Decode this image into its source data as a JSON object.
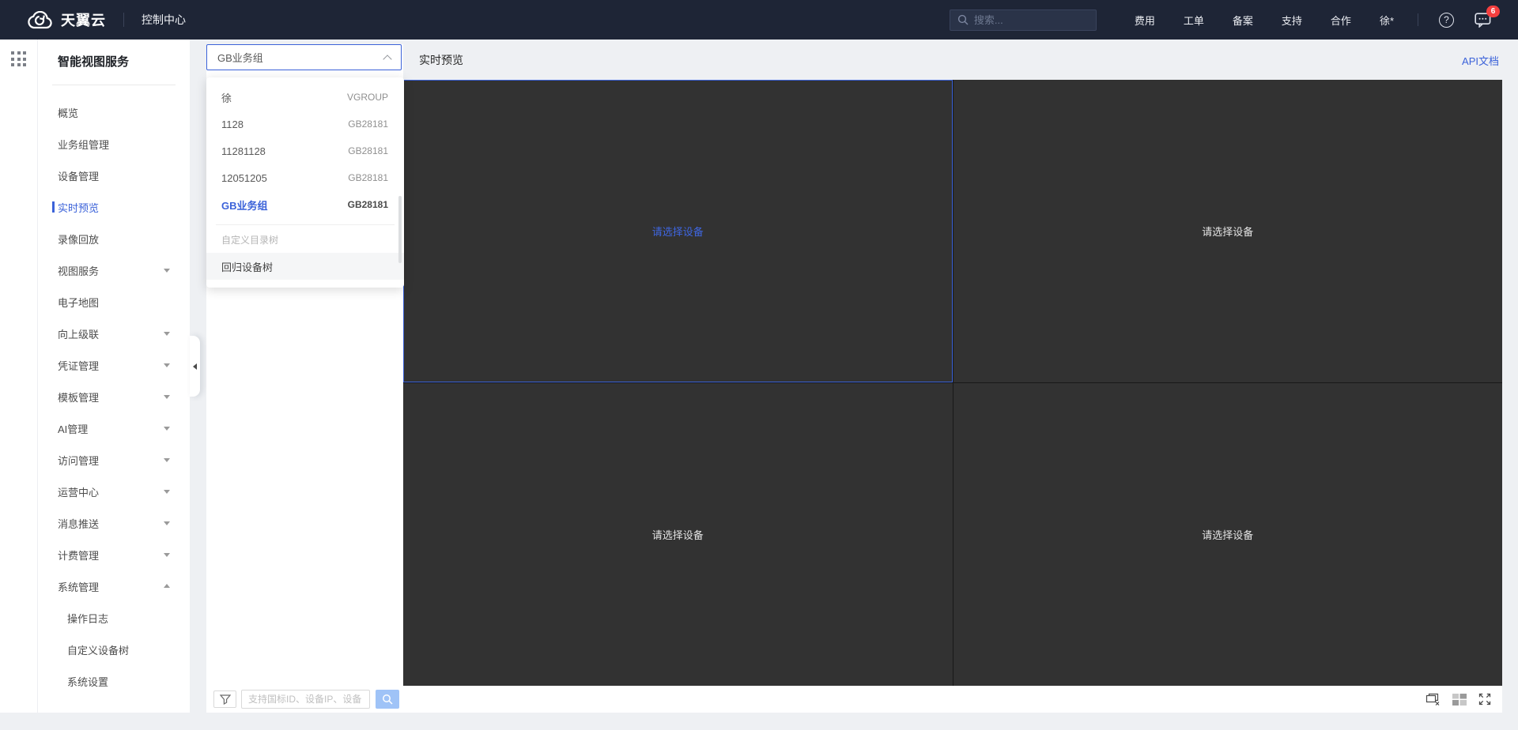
{
  "header": {
    "brand": "天翼云",
    "console": "控制中心",
    "search_placeholder": "搜索...",
    "nav": [
      {
        "label": "费用"
      },
      {
        "label": "工单"
      },
      {
        "label": "备案"
      },
      {
        "label": "支持"
      },
      {
        "label": "合作"
      },
      {
        "label": "徐*"
      }
    ],
    "help_glyph": "?",
    "message_badge": "6"
  },
  "app_sidebar": {
    "title": "智能视图服务",
    "items": [
      {
        "label": "概览"
      },
      {
        "label": "业务组管理"
      },
      {
        "label": "设备管理"
      },
      {
        "label": "实时预览"
      },
      {
        "label": "录像回放"
      },
      {
        "label": "视图服务"
      },
      {
        "label": "电子地图"
      },
      {
        "label": "向上级联"
      },
      {
        "label": "凭证管理"
      },
      {
        "label": "模板管理"
      },
      {
        "label": "AI管理"
      },
      {
        "label": "访问管理"
      },
      {
        "label": "运营中心"
      },
      {
        "label": "消息推送"
      },
      {
        "label": "计费管理"
      },
      {
        "label": "系统管理"
      }
    ],
    "subitems": [
      {
        "label": "操作日志"
      },
      {
        "label": "自定义设备树"
      },
      {
        "label": "系统设置"
      }
    ]
  },
  "page": {
    "title": "实时预览",
    "api_doc_link": "API文档"
  },
  "device_panel": {
    "group_select_value": "GB业务组",
    "dropdown_options": [
      {
        "name": "徐",
        "type": "VGROUP"
      },
      {
        "name": "1128",
        "type": "GB28181"
      },
      {
        "name": "11281128",
        "type": "GB28181"
      },
      {
        "name": "12051205",
        "type": "GB28181"
      },
      {
        "name": "GB业务组",
        "type": "GB28181"
      }
    ],
    "dropdown_group_label": "自定义目录树",
    "dropdown_tree_item": "回归设备树",
    "search_placeholder": "支持国标ID、设备IP、设备"
  },
  "video_grid": {
    "cell_placeholder": "请选择设备"
  },
  "colors": {
    "accent_blue": "#3b62d9",
    "header_bg": "#1e2536",
    "badge_red": "#f53f3f",
    "video_bg": "#323232",
    "search_button_blue": "#9fc3f7"
  }
}
